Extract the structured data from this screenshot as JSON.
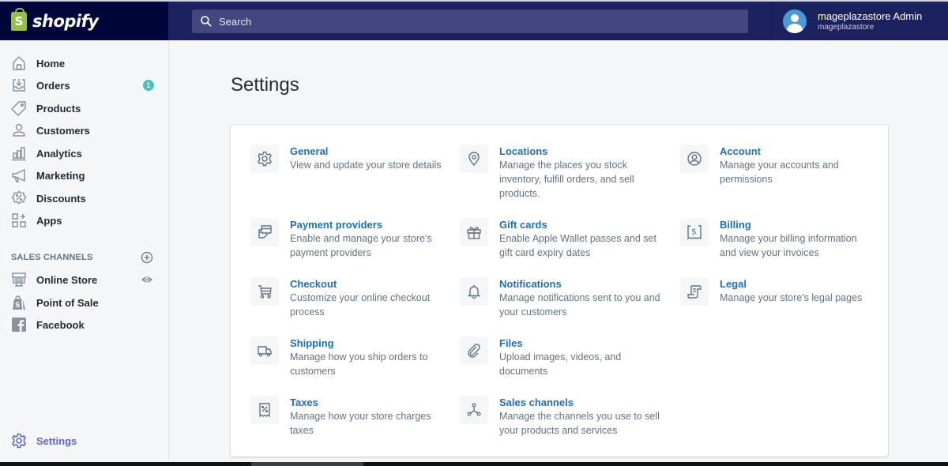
{
  "brand": {
    "name": "shopify",
    "logo_letter": "S",
    "color": "#95bf47"
  },
  "search": {
    "placeholder": "Search",
    "value": ""
  },
  "user": {
    "name": "mageplazastore Admin",
    "store": "mageplazastore"
  },
  "sidebar": {
    "items": [
      {
        "label": "Home",
        "icon": "home-icon"
      },
      {
        "label": "Orders",
        "icon": "orders-icon",
        "badge": "1"
      },
      {
        "label": "Products",
        "icon": "tag-icon"
      },
      {
        "label": "Customers",
        "icon": "customer-icon"
      },
      {
        "label": "Analytics",
        "icon": "analytics-icon"
      },
      {
        "label": "Marketing",
        "icon": "megaphone-icon"
      },
      {
        "label": "Discounts",
        "icon": "discount-icon"
      },
      {
        "label": "Apps",
        "icon": "apps-icon"
      }
    ],
    "sales_channels_title": "SALES CHANNELS",
    "channels": [
      {
        "label": "Online Store",
        "icon": "store-icon"
      },
      {
        "label": "Point of Sale",
        "icon": "pos-icon"
      },
      {
        "label": "Facebook",
        "icon": "facebook-icon"
      }
    ],
    "settings_label": "Settings"
  },
  "page": {
    "title": "Settings"
  },
  "settings": [
    {
      "title": "General",
      "desc": "View and update your store details",
      "icon": "gear-icon"
    },
    {
      "title": "Locations",
      "desc": "Manage the places you stock inventory, fulfill orders, and sell products.",
      "icon": "location-icon"
    },
    {
      "title": "Account",
      "desc": "Manage your accounts and permissions",
      "icon": "account-icon"
    },
    {
      "title": "Payment providers",
      "desc": "Enable and manage your store's payment providers",
      "icon": "payment-icon"
    },
    {
      "title": "Gift cards",
      "desc": "Enable Apple Wallet passes and set gift card expiry dates",
      "icon": "gift-icon"
    },
    {
      "title": "Billing",
      "desc": "Manage your billing information and view your invoices",
      "icon": "billing-icon"
    },
    {
      "title": "Checkout",
      "desc": "Customize your online checkout process",
      "icon": "cart-icon"
    },
    {
      "title": "Notifications",
      "desc": "Manage notifications sent to you and your customers",
      "icon": "bell-icon"
    },
    {
      "title": "Legal",
      "desc": "Manage your store's legal pages",
      "icon": "legal-icon"
    },
    {
      "title": "Shipping",
      "desc": "Manage how you ship orders to customers",
      "icon": "truck-icon"
    },
    {
      "title": "Files",
      "desc": "Upload images, videos, and documents",
      "icon": "paperclip-icon"
    },
    {
      "title": "Taxes",
      "desc": "Manage how your store charges taxes",
      "icon": "tax-icon"
    },
    {
      "title": "Sales channels",
      "desc": "Manage the channels you use to sell your products and services",
      "icon": "channels-icon"
    }
  ],
  "colors": {
    "topbar": "#1c2260",
    "logo_bg": "#000639",
    "link": "#1f6eb8",
    "badge": "#47c1bf",
    "active": "#5c6ac4"
  }
}
